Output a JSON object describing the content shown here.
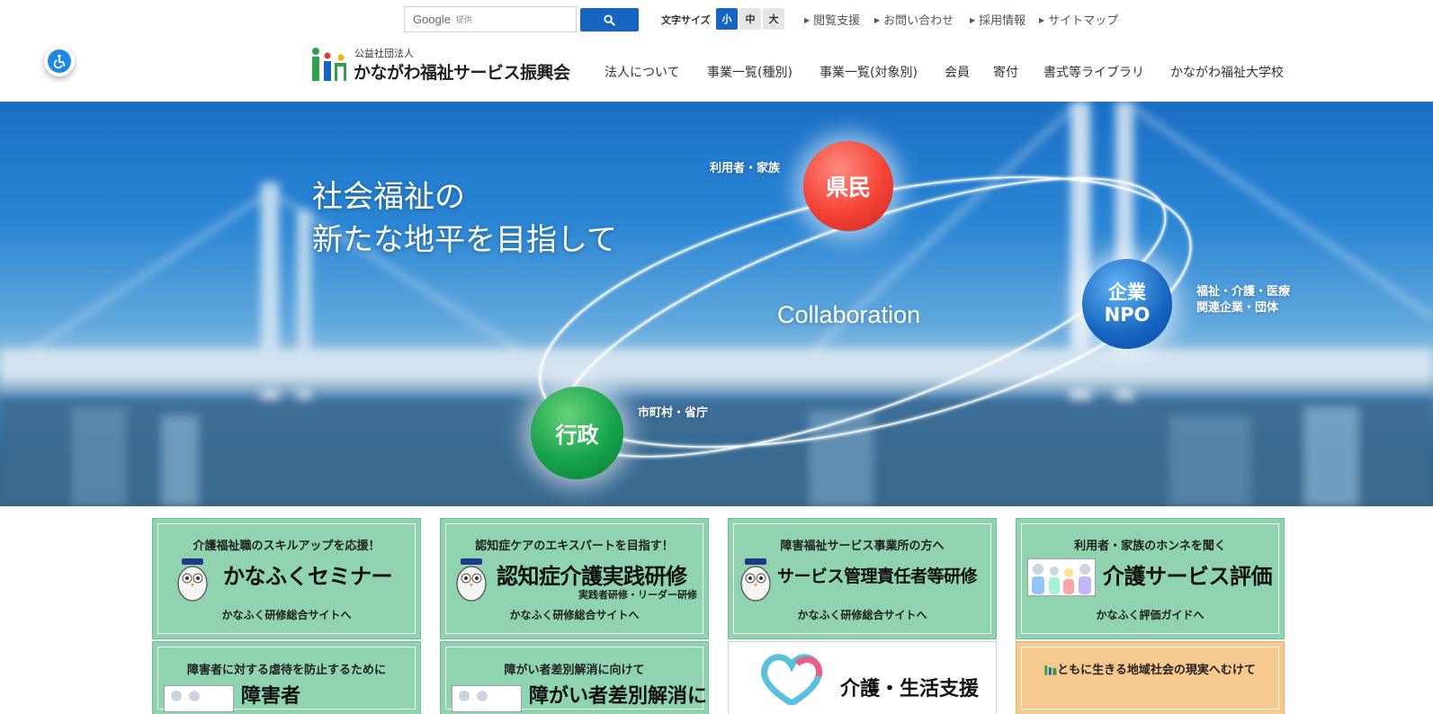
{
  "header": {
    "search": {
      "brand": "Google",
      "suffix": "提供"
    },
    "font_size": {
      "label": "文字サイズ",
      "small": "小",
      "medium": "中",
      "large": "大"
    },
    "util_links": [
      "閲覧支援",
      "お問い合わせ",
      "採用情報",
      "サイトマップ"
    ],
    "logo": {
      "org_type": "公益社団法人",
      "org_name": "かながわ福祉サービス振興会"
    },
    "nav": [
      "法人について",
      "事業一覧(種別)",
      "事業一覧(対象別)",
      "会員",
      "寄付",
      "書式等ライブラリ",
      "かながわ福祉大学校"
    ]
  },
  "hero": {
    "title_line1": "社会福祉の",
    "title_line2": "新たな地平を目指して",
    "collaboration": "Collaboration",
    "kenmin": "県民",
    "kenmin_caption": "利用者・家族",
    "npo_line1": "企業",
    "npo_line2": "NPO",
    "npo_caption_line1": "福祉・介護・医療",
    "npo_caption_line2": "関連企業・団体",
    "gyosei": "行政",
    "gyosei_caption": "市町村・省庁"
  },
  "banners": [
    {
      "head": "介護福祉職のスキルアップを応援！",
      "main": "かなふくセミナー",
      "sub": "",
      "link": "かなふく研修総合サイトへ"
    },
    {
      "head": "認知症ケアのエキスパートを目指す！",
      "main": "認知症介護実践研修",
      "sub": "実践者研修・リーダー研修",
      "link": "かなふく研修総合サイトへ"
    },
    {
      "head": "障害福祉サービス事業所の方へ",
      "main": "サービス管理責任者等研修",
      "sub": "",
      "link": "かなふく研修総合サイトへ"
    },
    {
      "head": "利用者・家族のホンネを聞く",
      "main": "介護サービス評価",
      "sub": "",
      "link": "かなふく評価ガイドへ"
    }
  ],
  "banners_row2": [
    {
      "head": "障害者に対する虐待を防止するために",
      "main": "障害者"
    },
    {
      "head": "障がい者差別解消に向けて",
      "main": "障がい者差別解消に"
    },
    {
      "head": "",
      "main": "介護・生活支援"
    },
    {
      "head": "ともに生きる地域社会の現実へむけて",
      "main": ""
    }
  ],
  "colors": {
    "accent": "#1565c0",
    "banner_green": "#8fd3b0",
    "banner_orange": "#f8c98e",
    "kenmin": "#f44336",
    "npo": "#1565c0",
    "gyosei": "#16a34a"
  }
}
